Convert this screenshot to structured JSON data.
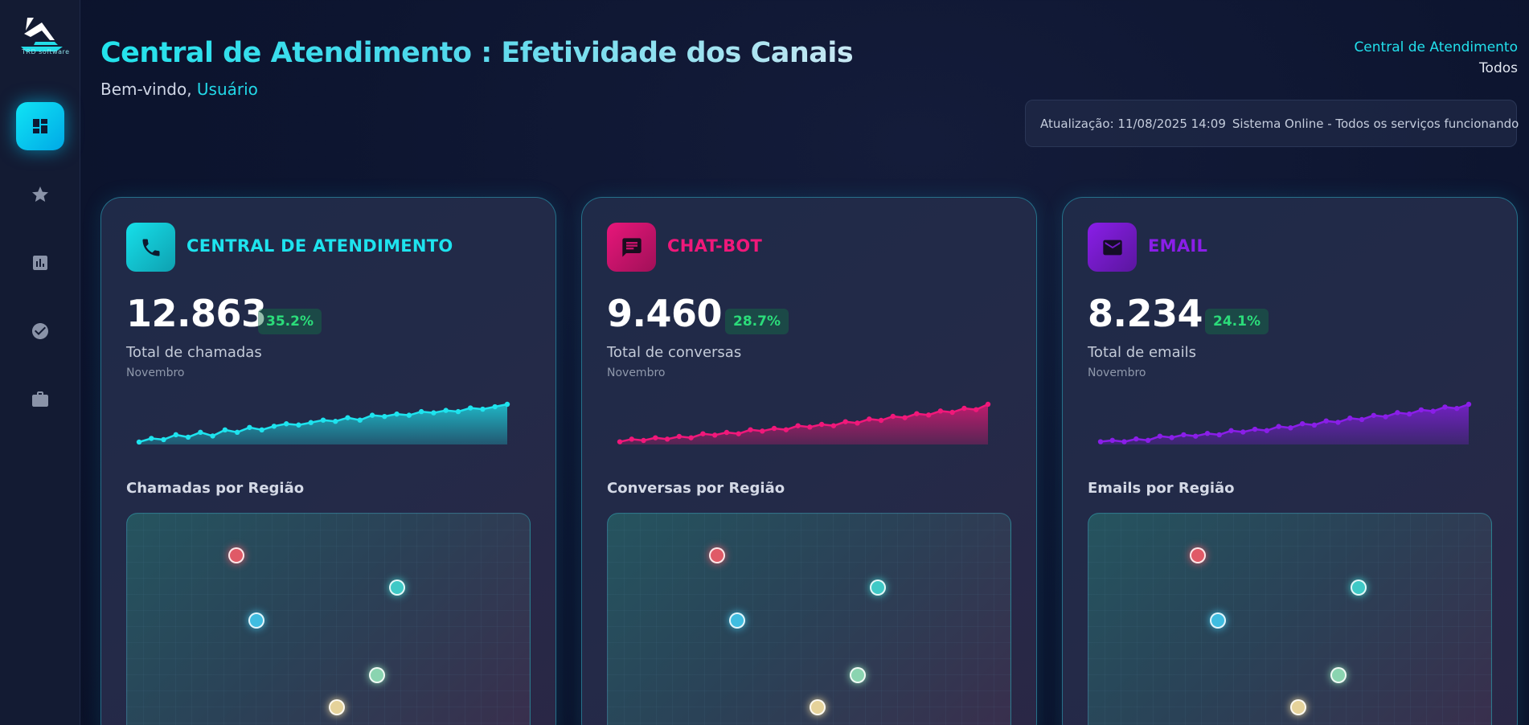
{
  "sidebar": {
    "logo_text": "TRD software",
    "items": [
      {
        "name": "dashboard",
        "icon": "dashboard-icon",
        "active": true
      },
      {
        "name": "favorites",
        "icon": "star-icon",
        "active": false
      },
      {
        "name": "reports",
        "icon": "bar-chart-icon",
        "active": false
      },
      {
        "name": "tasks",
        "icon": "check-circle-icon",
        "active": false
      },
      {
        "name": "portfolio",
        "icon": "briefcase-icon",
        "active": false
      }
    ]
  },
  "header": {
    "title": "Central de Atendimento : Efetividade dos Canais",
    "welcome_prefix": "Bem-vindo, ",
    "user": "Usuário",
    "context_label": "Central de Atendimento",
    "context_filter": "Todos",
    "update_label": "Atualização: 11/08/2025 14:09",
    "system_status": "Sistema Online - Todos os serviços funcionando"
  },
  "colors": {
    "central": "#1ee3ee",
    "chatbot": "#f0187a",
    "email": "#8a1ee8",
    "badge_green": "#2bdc7a"
  },
  "cards": [
    {
      "title": "CENTRAL DE ATENDIMENTO",
      "icon": "phone-icon",
      "value": "12.863",
      "percent": "35.2%",
      "label": "Total de chamadas",
      "month": "Novembro",
      "region_title": "Chamadas por Região"
    },
    {
      "title": "CHAT-BOT",
      "icon": "chat-icon",
      "value": "9.460",
      "percent": "28.7%",
      "label": "Total de conversas",
      "month": "Novembro",
      "region_title": "Conversas por Região"
    },
    {
      "title": "EMAIL",
      "icon": "mail-icon",
      "value": "8.234",
      "percent": "24.1%",
      "label": "Total de emails",
      "month": "Novembro",
      "region_title": "Emails por Região"
    }
  ],
  "chart_data": [
    {
      "type": "area",
      "series": [
        {
          "values": [
            2,
            5,
            4,
            8,
            6,
            10,
            7,
            12,
            10,
            14,
            12,
            15,
            17,
            16,
            18,
            20,
            19,
            22,
            20,
            24,
            23,
            25,
            24,
            27,
            26,
            28,
            27,
            30,
            29,
            31,
            33
          ]
        }
      ]
    },
    {
      "type": "area",
      "series": [
        {
          "values": [
            2,
            4,
            3,
            5,
            4,
            6,
            5,
            8,
            7,
            9,
            8,
            11,
            10,
            12,
            11,
            14,
            13,
            15,
            14,
            17,
            16,
            19,
            18,
            21,
            20,
            23,
            22,
            25,
            24,
            27,
            26,
            30
          ]
        }
      ]
    },
    {
      "type": "area",
      "series": [
        {
          "values": [
            2,
            3,
            2,
            4,
            3,
            6,
            5,
            7,
            6,
            8,
            7,
            10,
            9,
            11,
            10,
            13,
            12,
            15,
            14,
            17,
            16,
            19,
            18,
            21,
            20,
            23,
            22,
            25,
            24,
            27,
            26,
            29
          ]
        }
      ]
    }
  ],
  "region_dots": [
    {
      "color": "#e05a67"
    },
    {
      "color": "#3fc9c6"
    },
    {
      "color": "#3fbde0"
    },
    {
      "color": "#8ad4b0"
    },
    {
      "color": "#e5d29a"
    }
  ]
}
